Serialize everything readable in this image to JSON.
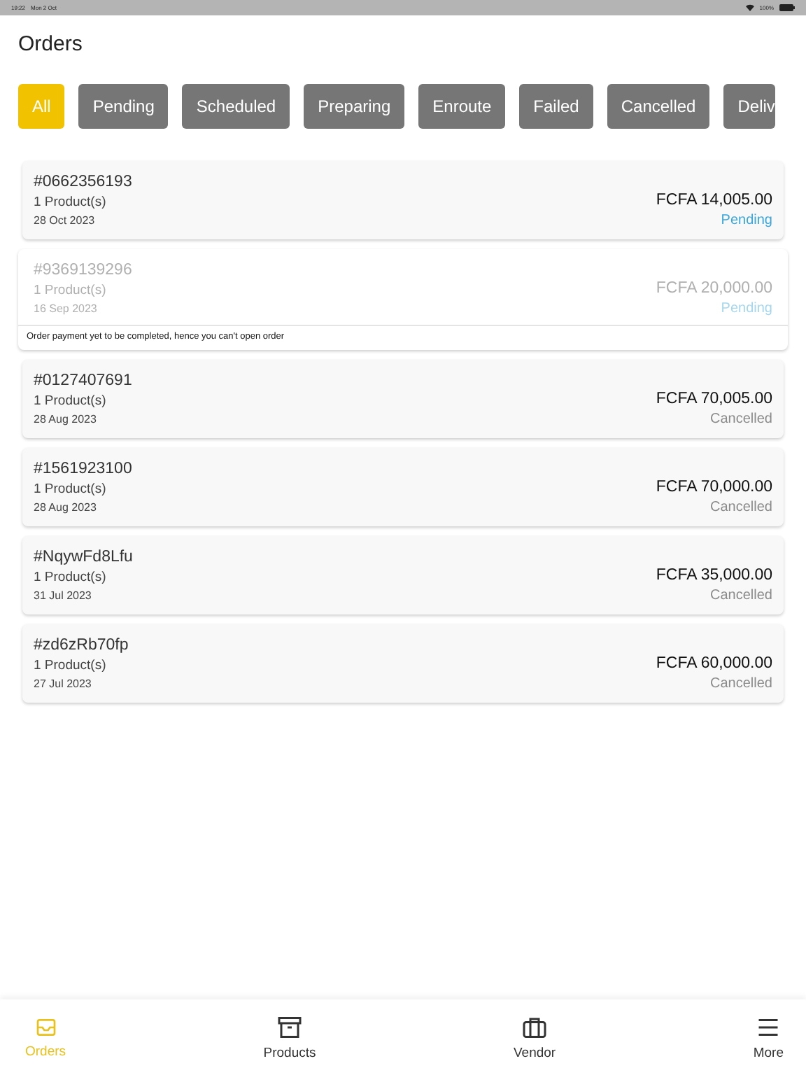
{
  "status_bar": {
    "time": "19:22",
    "date": "Mon 2 Oct",
    "battery": "100%"
  },
  "title": "Orders",
  "filters": [
    {
      "label": "All",
      "selected": true
    },
    {
      "label": "Pending",
      "selected": false
    },
    {
      "label": "Scheduled",
      "selected": false
    },
    {
      "label": "Preparing",
      "selected": false
    },
    {
      "label": "Enroute",
      "selected": false
    },
    {
      "label": "Failed",
      "selected": false
    },
    {
      "label": "Cancelled",
      "selected": false
    },
    {
      "label": "Deliv",
      "selected": false
    }
  ],
  "orders": [
    {
      "number": "#0662356193",
      "products": "1 Product(s)",
      "date": "28 Oct 2023",
      "amount": "FCFA 14,005.00",
      "status": "Pending",
      "kind": "pending",
      "disabled": false
    },
    {
      "number": "#9369139296",
      "products": "1 Product(s)",
      "date": "16 Sep 2023",
      "amount": "FCFA 20,000.00",
      "status": "Pending",
      "kind": "pending",
      "disabled": true,
      "note": "Order payment yet to be completed, hence you can't open order"
    },
    {
      "number": "#0127407691",
      "products": "1 Product(s)",
      "date": "28 Aug 2023",
      "amount": "FCFA 70,005.00",
      "status": "Cancelled",
      "kind": "cancelled",
      "disabled": false
    },
    {
      "number": "#1561923100",
      "products": "1 Product(s)",
      "date": "28 Aug 2023",
      "amount": "FCFA 70,000.00",
      "status": "Cancelled",
      "kind": "cancelled",
      "disabled": false
    },
    {
      "number": "#NqywFd8Lfu",
      "products": "1 Product(s)",
      "date": "31 Jul 2023",
      "amount": "FCFA 35,000.00",
      "status": "Cancelled",
      "kind": "cancelled",
      "disabled": false
    },
    {
      "number": "#zd6zRb70fp",
      "products": "1 Product(s)",
      "date": "27 Jul 2023",
      "amount": "FCFA 60,000.00",
      "status": "Cancelled",
      "kind": "cancelled",
      "disabled": false
    }
  ],
  "nav": [
    {
      "label": "Orders",
      "kind": "inbox",
      "selected": true
    },
    {
      "label": "Products",
      "kind": "archive",
      "selected": false
    },
    {
      "label": "Vendor",
      "kind": "briefcase",
      "selected": false
    },
    {
      "label": "More",
      "kind": "menu",
      "selected": false
    }
  ]
}
